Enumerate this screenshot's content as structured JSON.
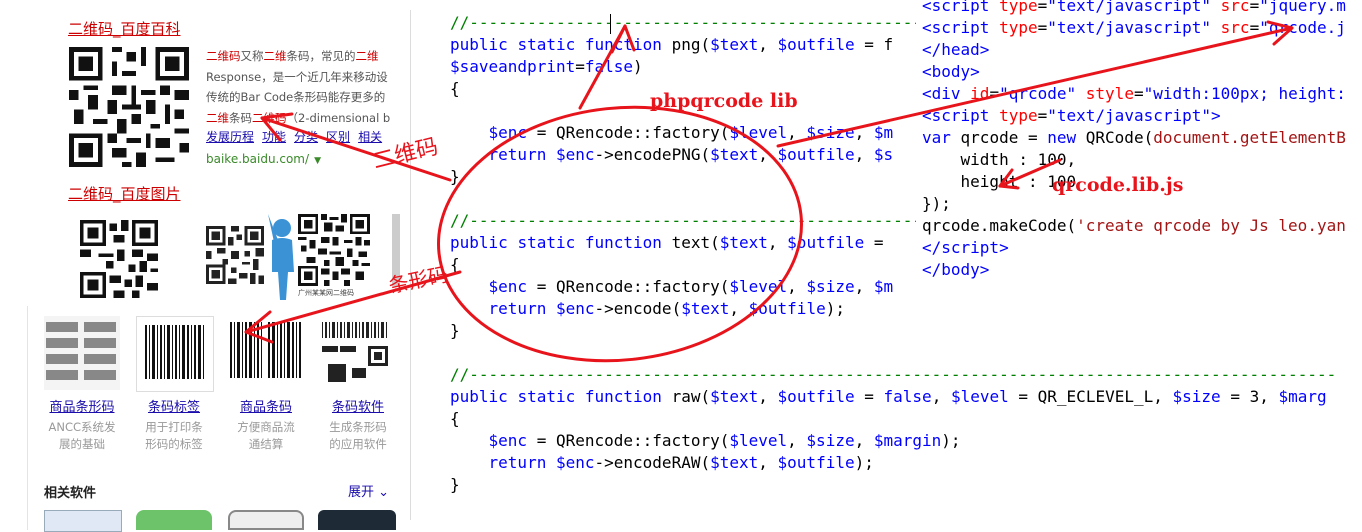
{
  "left": {
    "baike_title": "二维码_百度百科",
    "snippet_lines": [
      {
        "hl": "二维码",
        "pre": "",
        "mid": "又称",
        "hl2": "二维",
        "post": "条码，常见的",
        "hl3": "二维"
      },
      {
        "text": "Response，是一个近几年来移动设"
      },
      {
        "text": "传统的Bar Code条形码能存更多的"
      },
      {
        "hl": "二维",
        "mid": "条码",
        "hl2": "二维码",
        "post": "（2-dimensional b"
      }
    ],
    "related": [
      "发展历程",
      "功能",
      "分类",
      "区别",
      "相关"
    ],
    "url": "baike.baidu.com/",
    "images_title": "二维码_百度图片",
    "image_caption": "广州某某网二维码",
    "products": [
      {
        "title": "商品条形码",
        "desc1": "ANCC系统发",
        "desc2": "展的基础"
      },
      {
        "title": "条码标签",
        "desc1": "用于打印条",
        "desc2": "形码的标签"
      },
      {
        "title": "商品条码",
        "desc1": "方便商品流",
        "desc2": "通结算"
      },
      {
        "title": "条码软件",
        "desc1": "生成条形码",
        "desc2": "的应用软件"
      }
    ],
    "related_software": "相关软件",
    "expand": "展开"
  },
  "annotations": {
    "erweima": "二维码",
    "tiaoxingma": "条形码",
    "phpqrcode": "phpqrcode lib",
    "qrcodelib": "qrcode.lib.js"
  },
  "colors": {
    "accent_red": "#e8141c",
    "link_blue": "#1a0dab"
  }
}
